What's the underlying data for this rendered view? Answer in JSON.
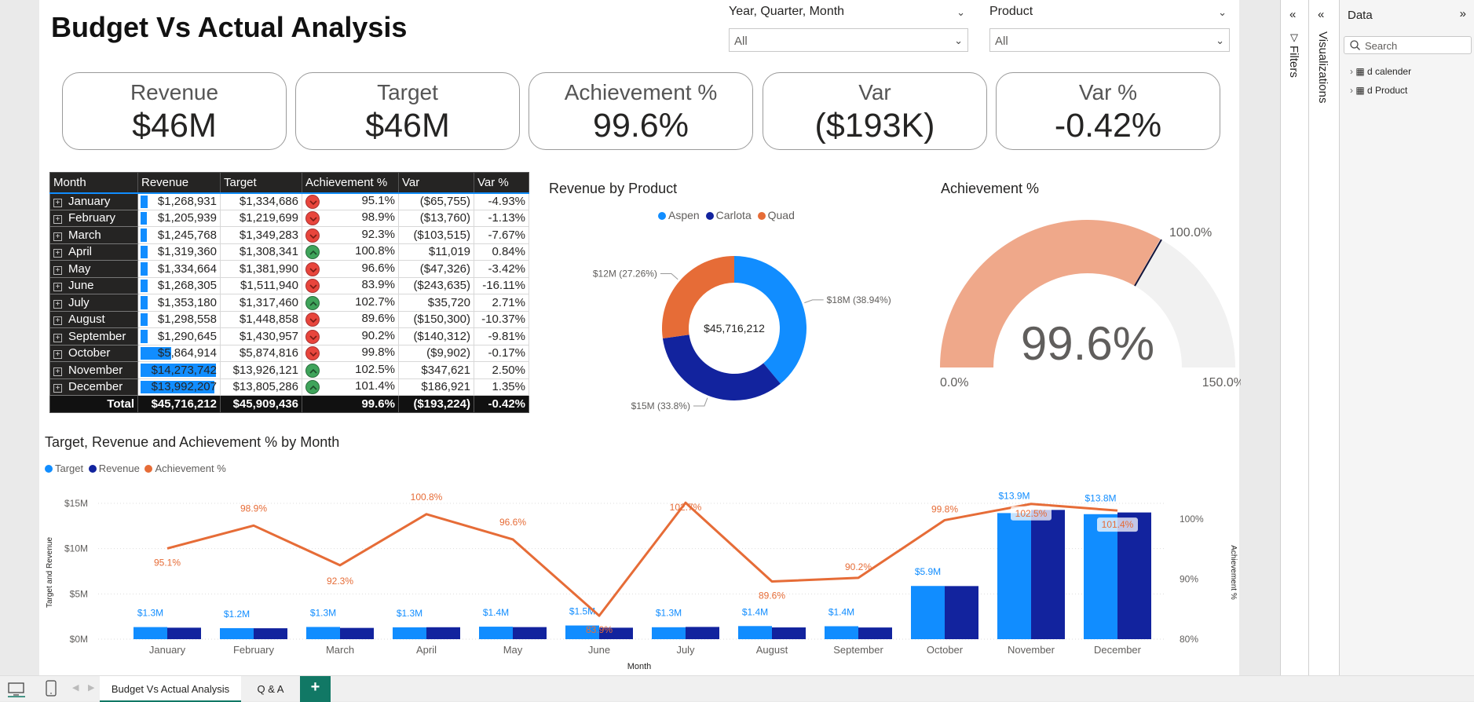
{
  "title": "Budget Vs Actual Analysis",
  "slicers": [
    {
      "label": "Year, Quarter, Month",
      "value": "All"
    },
    {
      "label": "Product",
      "value": "All"
    }
  ],
  "kpis": [
    {
      "label": "Revenue",
      "value": "$46M"
    },
    {
      "label": "Target",
      "value": "$46M"
    },
    {
      "label": "Achievement %",
      "value": "99.6%"
    },
    {
      "label": "Var",
      "value": "($193K)"
    },
    {
      "label": "Var %",
      "value": "-0.42%"
    }
  ],
  "table": {
    "headers": [
      "Month",
      "Revenue",
      "Target",
      "Achievement %",
      "Var",
      "Var %"
    ],
    "rows": [
      {
        "month": "January",
        "revenue": "$1,268,931",
        "target": "$1,334,686",
        "ach": "95.1%",
        "var": "($65,755)",
        "varp": "-4.93%",
        "status": "down",
        "rev_num": 1268931
      },
      {
        "month": "February",
        "revenue": "$1,205,939",
        "target": "$1,219,699",
        "ach": "98.9%",
        "var": "($13,760)",
        "varp": "-1.13%",
        "status": "down",
        "rev_num": 1205939
      },
      {
        "month": "March",
        "revenue": "$1,245,768",
        "target": "$1,349,283",
        "ach": "92.3%",
        "var": "($103,515)",
        "varp": "-7.67%",
        "status": "down",
        "rev_num": 1245768
      },
      {
        "month": "April",
        "revenue": "$1,319,360",
        "target": "$1,308,341",
        "ach": "100.8%",
        "var": "$11,019",
        "varp": "0.84%",
        "status": "up",
        "rev_num": 1319360
      },
      {
        "month": "May",
        "revenue": "$1,334,664",
        "target": "$1,381,990",
        "ach": "96.6%",
        "var": "($47,326)",
        "varp": "-3.42%",
        "status": "down",
        "rev_num": 1334664
      },
      {
        "month": "June",
        "revenue": "$1,268,305",
        "target": "$1,511,940",
        "ach": "83.9%",
        "var": "($243,635)",
        "varp": "-16.11%",
        "status": "down",
        "rev_num": 1268305
      },
      {
        "month": "July",
        "revenue": "$1,353,180",
        "target": "$1,317,460",
        "ach": "102.7%",
        "var": "$35,720",
        "varp": "2.71%",
        "status": "up",
        "rev_num": 1353180
      },
      {
        "month": "August",
        "revenue": "$1,298,558",
        "target": "$1,448,858",
        "ach": "89.6%",
        "var": "($150,300)",
        "varp": "-10.37%",
        "status": "down",
        "rev_num": 1298558
      },
      {
        "month": "September",
        "revenue": "$1,290,645",
        "target": "$1,430,957",
        "ach": "90.2%",
        "var": "($140,312)",
        "varp": "-9.81%",
        "status": "down",
        "rev_num": 1290645
      },
      {
        "month": "October",
        "revenue": "$5,864,914",
        "target": "$5,874,816",
        "ach": "99.8%",
        "var": "($9,902)",
        "varp": "-0.17%",
        "status": "down",
        "rev_num": 5864914
      },
      {
        "month": "November",
        "revenue": "$14,273,742",
        "target": "$13,926,121",
        "ach": "102.5%",
        "var": "$347,621",
        "varp": "2.50%",
        "status": "up",
        "rev_num": 14273742
      },
      {
        "month": "December",
        "revenue": "$13,992,207",
        "target": "$13,805,286",
        "ach": "101.4%",
        "var": "$186,921",
        "varp": "1.35%",
        "status": "up",
        "rev_num": 13992207
      }
    ],
    "total": {
      "label": "Total",
      "revenue": "$45,716,212",
      "target": "$45,909,436",
      "ach": "99.6%",
      "var": "($193,224)",
      "varp": "-0.42%"
    }
  },
  "chart_data": [
    {
      "type": "pie",
      "title": "Revenue by Product",
      "donut": true,
      "center_label": "$45,716,212",
      "categories": [
        "Aspen",
        "Carlota",
        "Quad"
      ],
      "values": [
        38.94,
        33.8,
        27.26
      ],
      "data_labels": [
        "$18M (38.94%)",
        "$15M (33.8%)",
        "$12M (27.26%)"
      ],
      "colors": [
        "#118DFF",
        "#12239E",
        "#E66C37"
      ],
      "legend": "top"
    },
    {
      "type": "gauge",
      "title": "Achievement %",
      "value": 99.6,
      "value_label": "99.6%",
      "min": 0,
      "max": 150,
      "target": 100,
      "min_label": "0.0%",
      "max_label": "150.0%",
      "target_label": "100.0%",
      "fill_color": "#EFA88A",
      "track_color": "#F1F1F1"
    },
    {
      "type": "bar",
      "title": "Target, Revenue and Achievement % by Month",
      "xlabel": "Month",
      "ylabel": "Target and Revenue",
      "y2label": "Achievement %",
      "categories": [
        "January",
        "February",
        "March",
        "April",
        "May",
        "June",
        "July",
        "August",
        "September",
        "October",
        "November",
        "December"
      ],
      "ylim": [
        0,
        15000000
      ],
      "y_ticks": [
        "$0M",
        "$5M",
        "$10M",
        "$15M"
      ],
      "y2lim": [
        80,
        102.6
      ],
      "y2_ticks": [
        "80%",
        "90%",
        "100%"
      ],
      "grid": true,
      "legend": "top-left",
      "series": [
        {
          "name": "Target",
          "type": "bar",
          "color": "#118DFF",
          "values": [
            1334686,
            1219699,
            1349283,
            1308341,
            1381990,
            1511940,
            1317460,
            1448858,
            1430957,
            5874816,
            13926121,
            13805286
          ],
          "labels": [
            "$1.3M",
            "$1.2M",
            "$1.3M",
            "$1.3M",
            "$1.4M",
            "$1.5M",
            "$1.3M",
            "$1.4M",
            "$1.4M",
            "$5.9M",
            "$13.9M",
            "$13.8M"
          ]
        },
        {
          "name": "Revenue",
          "type": "bar",
          "color": "#12239E",
          "values": [
            1268931,
            1205939,
            1245768,
            1319360,
            1334664,
            1268305,
            1353180,
            1298558,
            1290645,
            5864914,
            14273742,
            13992207
          ]
        },
        {
          "name": "Achievement %",
          "type": "line",
          "axis": "right",
          "color": "#E66C37",
          "values": [
            95.1,
            98.9,
            92.3,
            100.8,
            96.6,
            83.9,
            102.7,
            89.6,
            90.2,
            99.8,
            102.5,
            101.4
          ],
          "labels": [
            "95.1%",
            "98.9%",
            "92.3%",
            "100.8%",
            "96.6%",
            "83.9%",
            "102.7%",
            "89.6%",
            "90.2%",
            "99.8%",
            "102.5%",
            "101.4%"
          ]
        }
      ]
    }
  ],
  "panes": {
    "filters": "Filters",
    "visualizations": "Visualizations",
    "data": {
      "title": "Data",
      "search_placeholder": "Search",
      "items": [
        "d calender",
        "d Product"
      ]
    }
  },
  "bottom": {
    "tabs": [
      "Budget Vs Actual Analysis",
      "Q & A"
    ],
    "add": "+"
  }
}
